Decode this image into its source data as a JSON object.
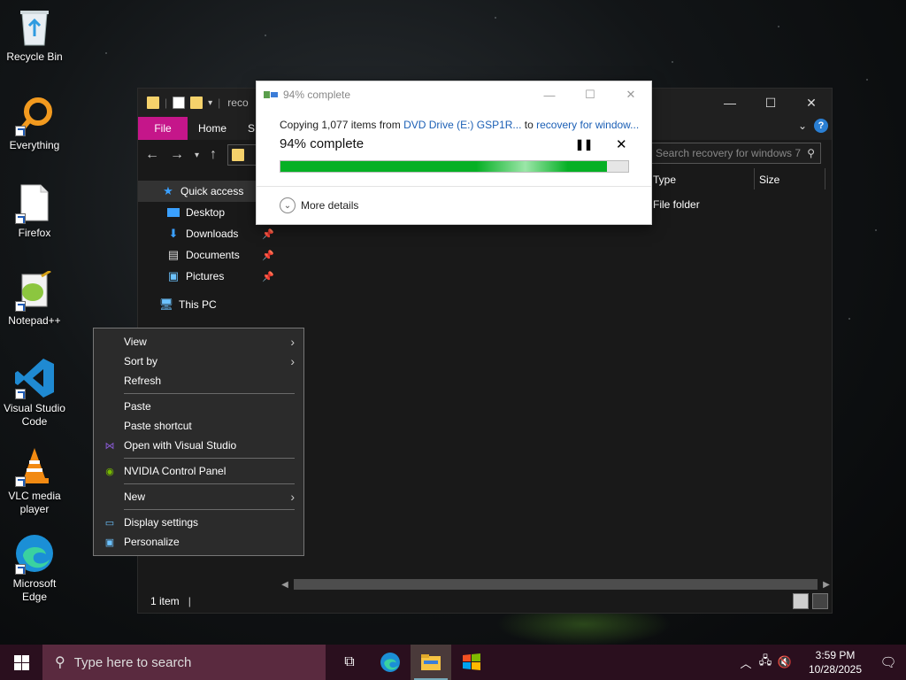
{
  "desktop": {
    "icons": [
      {
        "label": "Recycle Bin"
      },
      {
        "label": "Everything"
      },
      {
        "label": "Firefox"
      },
      {
        "label": "Notepad++"
      },
      {
        "label": "Visual Studio Code"
      },
      {
        "label": "VLC media player"
      },
      {
        "label": "Microsoft Edge"
      }
    ]
  },
  "explorer": {
    "title": "reco",
    "tabs": [
      "File",
      "Home",
      "S"
    ],
    "search_placeholder": "Search recovery for windows 7",
    "nav": [
      {
        "label": "Quick access"
      },
      {
        "label": "Desktop"
      },
      {
        "label": "Downloads"
      },
      {
        "label": "Documents"
      },
      {
        "label": "Pictures"
      },
      {
        "label": "This PC"
      }
    ],
    "columns": {
      "type": "Type",
      "size": "Size"
    },
    "row_type": "File folder",
    "status": "1 item"
  },
  "copy_dialog": {
    "title": "94% complete",
    "copy_prefix": "Copying 1,077 items from",
    "source": "DVD Drive (E:) GSP1R...",
    "to": "to",
    "destination": "recovery for window...",
    "percent_label": "94% complete",
    "progress": 0.94,
    "more_details": "More details"
  },
  "context_menu": {
    "view": "View",
    "sort_by": "Sort by",
    "refresh": "Refresh",
    "paste": "Paste",
    "paste_shortcut": "Paste shortcut",
    "open_vs": "Open with Visual Studio",
    "nvidia": "NVIDIA Control Panel",
    "new": "New",
    "display_settings": "Display settings",
    "personalize": "Personalize"
  },
  "taskbar": {
    "search_placeholder": "Type here to search",
    "time": "3:59 PM",
    "date": "10/28/2025"
  }
}
